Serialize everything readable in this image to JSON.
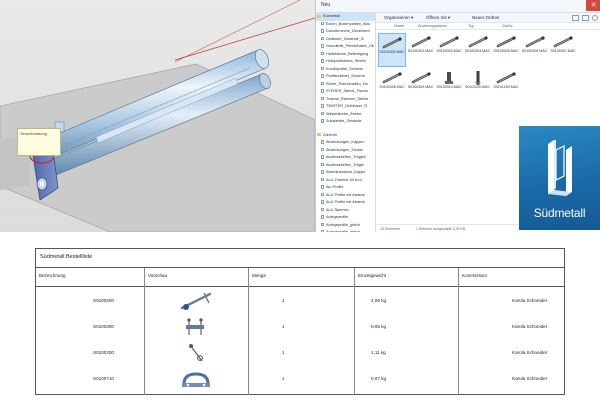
{
  "cad_view": {
    "tooltip_text": "Verschraubung"
  },
  "explorer": {
    "breadcrumb": "Neu",
    "close_glyph": "✕",
    "sidebar": {
      "items": [
        {
          "label": "Sudmetall",
          "kind": "folder",
          "selected": true
        },
        {
          "label": "Ecken_Bodenplatten_Bau",
          "kind": "doc"
        },
        {
          "label": "Durchbrueche_Deckblech",
          "kind": "doc"
        },
        {
          "label": "Geländer_Gewinde_N",
          "kind": "doc"
        },
        {
          "label": "Grundteile_Pendelhalter_Hk",
          "kind": "doc"
        },
        {
          "label": "Haltebleche_Befestigung",
          "kind": "doc"
        },
        {
          "label": "Hohlprofilstrebe_Strebe",
          "kind": "doc"
        },
        {
          "label": "Kombiprofile_Schiene",
          "kind": "doc"
        },
        {
          "label": "Profilschieber_Schiene",
          "kind": "doc"
        },
        {
          "label": "Rohre_Rohrschellen_Ha",
          "kind": "doc"
        },
        {
          "label": "STEHER_Steher_Flachs",
          "kind": "doc"
        },
        {
          "label": "Traeme_Rahmen_Steher",
          "kind": "doc"
        },
        {
          "label": "TWISTER_Drehbarer_R",
          "kind": "doc"
        },
        {
          "label": "Winkelstrebe_Strebe",
          "kind": "doc"
        },
        {
          "label": "Zusatzteile_Gewinde",
          "kind": "doc"
        },
        {
          "label": "Zubehör",
          "kind": "folder"
        },
        {
          "label": "Abdeckungen_Kappen",
          "kind": "doc"
        },
        {
          "label": "Abdeckungen_Sockel",
          "kind": "doc"
        },
        {
          "label": "Abdeckstreifen_Tragteil",
          "kind": "doc"
        },
        {
          "label": "Abdeckstreifen_Trägel",
          "kind": "doc"
        },
        {
          "label": "Abschlussstück_Kappe",
          "kind": "doc"
        },
        {
          "label": "ALU Zubehör für ALU",
          "kind": "doc"
        },
        {
          "label": "Alu Profile",
          "kind": "doc"
        },
        {
          "label": "ALU Profile mit Abdeck",
          "kind": "doc"
        },
        {
          "label": "ALU Profile mit Abdeck",
          "kind": "doc"
        },
        {
          "label": "ALU Rahmen",
          "kind": "doc"
        },
        {
          "label": "Anlegeprofile",
          "kind": "doc"
        },
        {
          "label": "Anlegeprofile_gleich",
          "kind": "doc"
        },
        {
          "label": "Anlegeprofile_gleich",
          "kind": "doc"
        },
        {
          "label": "Anlegeprofil_Verbindung",
          "kind": "doc"
        },
        {
          "label": "Anschweißblech",
          "kind": "doc"
        },
        {
          "label": "Anschweißblech_Steher",
          "kind": "doc"
        },
        {
          "label": "Ausgleichsschraube",
          "kind": "doc"
        },
        {
          "label": "Ausgleichsstücke_Schrau",
          "kind": "doc"
        }
      ]
    },
    "toolbar": {
      "organize_label": "Organisieren ▾",
      "open_label": "Öffnen mit ▾",
      "new_folder_label": "Neuer Ordner"
    },
    "columns": [
      "Name",
      "Änderungsdatum",
      "Typ",
      "Größe"
    ],
    "files": [
      {
        "name": "S0100300.MAC",
        "kind": "rod",
        "selected": true
      },
      {
        "name": "S0100302.MAC",
        "kind": "rod",
        "selected": false
      },
      {
        "name": "S0100303.MAC",
        "kind": "rod",
        "selected": false
      },
      {
        "name": "S0100304.MAC",
        "kind": "rod",
        "selected": false
      },
      {
        "name": "S0100305.MAC",
        "kind": "rod",
        "selected": false
      },
      {
        "name": "S0100306.MAC",
        "kind": "rod",
        "selected": false
      },
      {
        "name": "S0100307.MAC",
        "kind": "rod",
        "selected": false
      },
      {
        "name": "S0100308.MAC",
        "kind": "rod",
        "selected": false
      },
      {
        "name": "S0100309.MAC",
        "kind": "rod",
        "selected": false
      },
      {
        "name": "S0100310.MAC",
        "kind": "bracket",
        "selected": false
      },
      {
        "name": "S0101100.MAC",
        "kind": "post",
        "selected": false
      },
      {
        "name": "S0101200.MAC",
        "kind": "rod",
        "selected": false
      }
    ],
    "status": {
      "count": "13 Elemente",
      "selection": "1 Element ausgewählt 3,29 KB"
    }
  },
  "logo": {
    "brand_name": "Südmetall",
    "colors": {
      "top": "#2b8ac3",
      "bottom": "#155993"
    }
  },
  "order_list": {
    "title": "Südmetall Bestellliste",
    "headers": {
      "article": "Bezeichnung",
      "preview": "Vorschau",
      "quantity": "Menge",
      "weight": "Einzelgewicht",
      "comment": "Kommission"
    },
    "rows": [
      {
        "article": "S0100300",
        "preview_icon": "rod-with-bolts",
        "quantity": "1",
        "weight": "4,06 kg",
        "comment": "Karola Schneider"
      },
      {
        "article": "S0100300",
        "preview_icon": "double-bolt",
        "quantity": "1",
        "weight": "0,65 kg",
        "comment": "Karola Schneider"
      },
      {
        "article": "S0100300",
        "preview_icon": "threaded-hook",
        "quantity": "1",
        "weight": "1,11 kg",
        "comment": "Karola Schneider"
      },
      {
        "article": "S0100710",
        "preview_icon": "clamp-bracket",
        "quantity": "1",
        "weight": "0,67 kg",
        "comment": "Karola Schneider"
      }
    ]
  }
}
